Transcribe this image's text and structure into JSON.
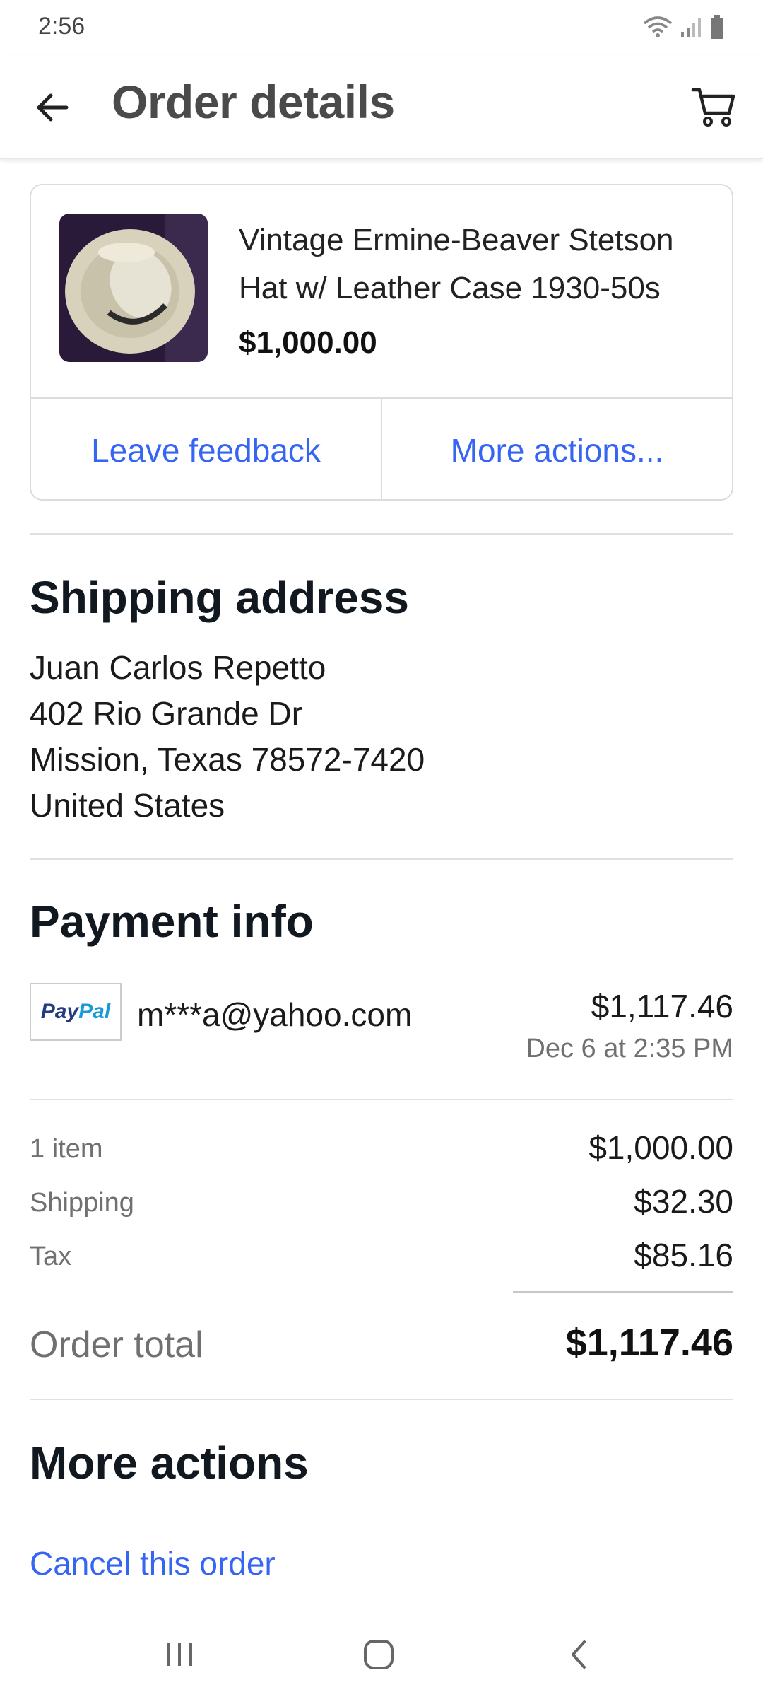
{
  "status_bar": {
    "time": "2:56",
    "icons": [
      "wifi-icon",
      "signal-icon",
      "battery-icon"
    ]
  },
  "header": {
    "title": "Order details",
    "back_icon": "arrow-left-icon",
    "cart_icon": "cart-icon"
  },
  "item": {
    "title": "Vintage Ermine-Beaver Stetson Hat w/ Leather Case 1930-50s",
    "price": "$1,000.00",
    "actions": {
      "leave_feedback": "Leave feedback",
      "more_actions": "More actions..."
    }
  },
  "shipping": {
    "heading": "Shipping address",
    "name": "Juan Carlos Repetto",
    "street": "402 Rio Grande Dr",
    "city_line": "Mission, Texas 78572-7420",
    "country": "United States"
  },
  "payment": {
    "heading": "Payment info",
    "method_logo": {
      "part1": "Pay",
      "part2": "Pal"
    },
    "email": "m***a@yahoo.com",
    "amount": "$1,117.46",
    "date": "Dec 6 at 2:35 PM"
  },
  "summary": {
    "items_label": "1 item",
    "items_value": "$1,000.00",
    "shipping_label": "Shipping",
    "shipping_value": "$32.30",
    "tax_label": "Tax",
    "tax_value": "$85.16",
    "total_label": "Order total",
    "total_value": "$1,117.46"
  },
  "more_actions": {
    "heading": "More actions",
    "cancel_label": "Cancel this order"
  },
  "colors": {
    "link": "#3665f3",
    "muted": "#707070",
    "paypal_dark": "#253b80",
    "paypal_light": "#179bd7"
  }
}
